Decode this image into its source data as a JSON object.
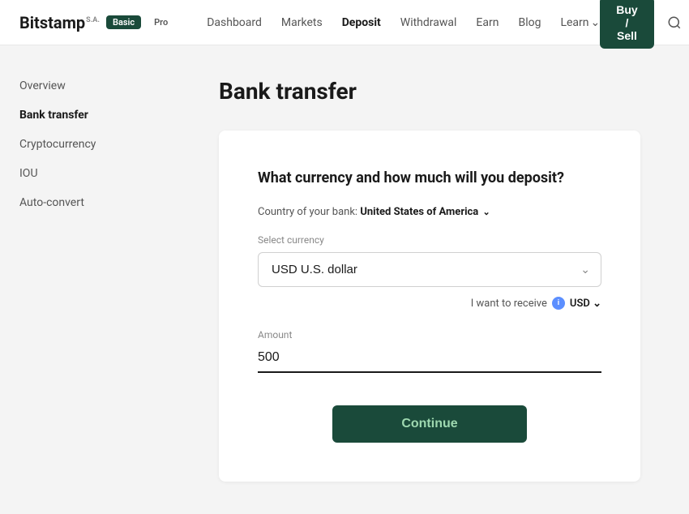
{
  "logo": {
    "name": "Bitstamp",
    "suffix": "S.A.",
    "badge_basic": "Basic",
    "badge_pro": "Pro"
  },
  "nav": {
    "items": [
      {
        "label": "Dashboard",
        "active": false
      },
      {
        "label": "Markets",
        "active": false
      },
      {
        "label": "Deposit",
        "active": true
      },
      {
        "label": "Withdrawal",
        "active": false
      },
      {
        "label": "Earn",
        "active": false
      },
      {
        "label": "Blog",
        "active": false
      },
      {
        "label": "Learn",
        "active": false,
        "has_chevron": true
      }
    ],
    "buy_sell_label": "Buy / Sell"
  },
  "sidebar": {
    "items": [
      {
        "label": "Overview",
        "active": false
      },
      {
        "label": "Bank transfer",
        "active": true
      },
      {
        "label": "Cryptocurrency",
        "active": false
      },
      {
        "label": "IOU",
        "active": false
      },
      {
        "label": "Auto-convert",
        "active": false
      }
    ]
  },
  "page": {
    "title": "Bank transfer"
  },
  "card": {
    "title": "What currency and how much will you deposit?",
    "country_label": "Country of your bank:",
    "country_value": "United States of America",
    "select_currency_label": "Select currency",
    "currency_option": "USD  U.S. dollar",
    "receive_prefix": "I want to receive",
    "receive_currency": "USD",
    "amount_label": "Amount",
    "amount_value": "500",
    "continue_label": "Continue"
  }
}
